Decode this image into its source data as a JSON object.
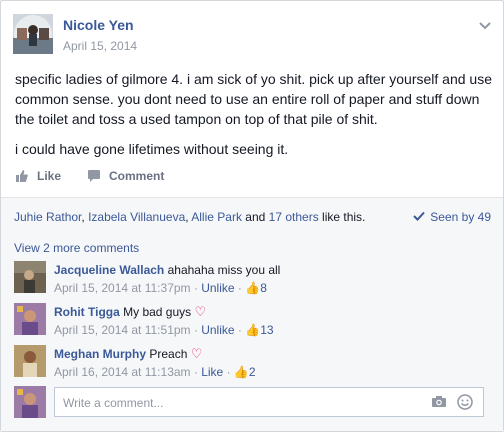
{
  "post": {
    "author": "Nicole Yen",
    "date": "April 15, 2014",
    "paragraphs": [
      "specific ladies of gilmore 4. i am sick of yo shit. pick up after yourself and use common sense. you dont need to use an entire roll of paper and stuff down the toilet and toss a used tampon on top of that pile of shit.",
      "i could have gone lifetimes without seeing it."
    ]
  },
  "actions": {
    "like": "Like",
    "comment": "Comment"
  },
  "likes": {
    "name1": "Juhie Rathor",
    "name2": "Izabela Villanueva",
    "name3": "Allie Park",
    "and": " and ",
    "others": "17 others",
    "suffix": " like this.",
    "seen": "Seen by 49"
  },
  "comments": {
    "view_more": "View 2 more comments",
    "items": [
      {
        "author": "Jacqueline Wallach",
        "text": "ahahaha miss you all",
        "time": "April 15, 2014 at 11:37pm",
        "action": "Unlike",
        "likes": "8"
      },
      {
        "author": "Rohit Tigga",
        "text": "My bad guys",
        "time": "April 15, 2014 at 11:51pm",
        "action": "Unlike",
        "likes": "13"
      },
      {
        "author": "Meghan Murphy",
        "text": "Preach",
        "time": "April 16, 2014 at 11:13am",
        "action": "Like",
        "likes": "2"
      }
    ]
  },
  "composer": {
    "placeholder": "Write a comment..."
  },
  "colors": {
    "link": "#3b5998",
    "meta": "#9197a3",
    "heart": "#e0245e",
    "bg": "#f6f7f9"
  },
  "icons": [
    "chevron-down-icon",
    "like-thumb-icon",
    "comment-bubble-icon",
    "checkmark-icon",
    "thumb-up-icon",
    "heart-icon",
    "camera-icon",
    "emoji-icon"
  ]
}
